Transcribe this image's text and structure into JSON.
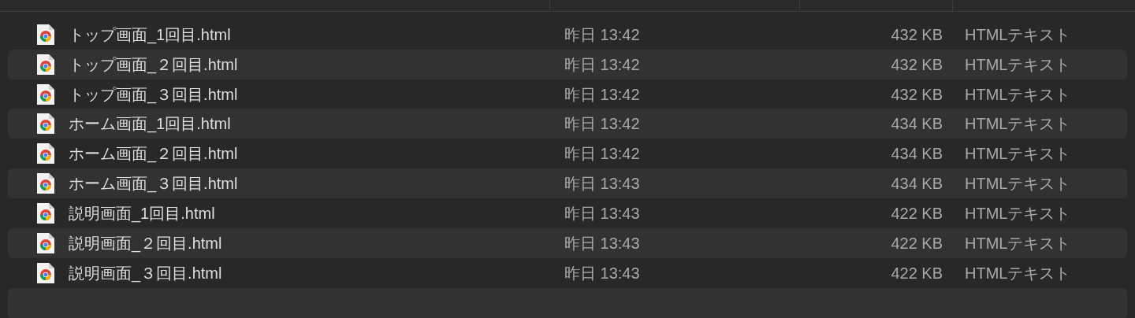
{
  "files": [
    {
      "name": "トップ画面_1回目.html",
      "modified": "昨日 13:42",
      "size": "432 KB",
      "kind": "HTMLテキスト"
    },
    {
      "name": "トップ画面_２回目.html",
      "modified": "昨日 13:42",
      "size": "432 KB",
      "kind": "HTMLテキスト"
    },
    {
      "name": "トップ画面_３回目.html",
      "modified": "昨日 13:42",
      "size": "432 KB",
      "kind": "HTMLテキスト"
    },
    {
      "name": "ホーム画面_1回目.html",
      "modified": "昨日 13:42",
      "size": "434 KB",
      "kind": "HTMLテキスト"
    },
    {
      "name": "ホーム画面_２回目.html",
      "modified": "昨日 13:42",
      "size": "434 KB",
      "kind": "HTMLテキスト"
    },
    {
      "name": "ホーム画面_３回目.html",
      "modified": "昨日 13:43",
      "size": "434 KB",
      "kind": "HTMLテキスト"
    },
    {
      "name": "説明画面_1回目.html",
      "modified": "昨日 13:43",
      "size": "422 KB",
      "kind": "HTMLテキスト"
    },
    {
      "name": "説明画面_２回目.html",
      "modified": "昨日 13:43",
      "size": "422 KB",
      "kind": "HTMLテキスト"
    },
    {
      "name": "説明画面_３回目.html",
      "modified": "昨日 13:43",
      "size": "422 KB",
      "kind": "HTMLテキスト"
    }
  ]
}
